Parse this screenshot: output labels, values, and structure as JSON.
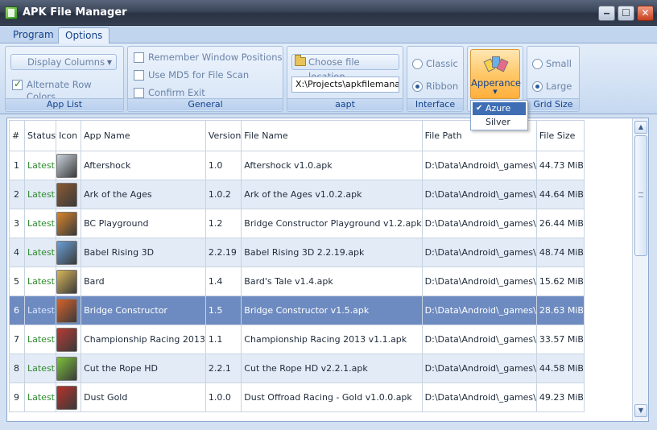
{
  "window": {
    "title": "APK File Manager",
    "minimize": "‒",
    "maximize": "☐",
    "close": "✕"
  },
  "tabs": [
    {
      "label": "Program"
    },
    {
      "label": "Options"
    }
  ],
  "ribbon": {
    "app_list": {
      "label": "App List",
      "display_columns": "Display Columns",
      "alternate_row_colors": "Alternate Row Colors",
      "alternate_row_colors_checked": true
    },
    "general": {
      "label": "General",
      "remember_window_positions": "Remember Window Positions",
      "use_md5": "Use MD5 for File Scan",
      "confirm_exit": "Confirm Exit"
    },
    "aapt": {
      "label": "aapt",
      "choose_file_location": "Choose file location",
      "path_value": "X:\\Projects\\apkfilemanage"
    },
    "interface": {
      "label": "Interface",
      "classic": "Classic",
      "ribbon": "Ribbon",
      "selected": "Ribbon"
    },
    "appearance": {
      "label": "Apperance",
      "options": [
        "Azure",
        "Silver"
      ],
      "selected": "Azure"
    },
    "grid_size": {
      "label": "Grid Size",
      "small": "Small",
      "large": "Large",
      "selected": "Large"
    }
  },
  "grid": {
    "columns": [
      "#",
      "Status",
      "Icon",
      "App Name",
      "Version",
      "File Name",
      "File Path",
      "File Size"
    ],
    "rows": [
      {
        "num": "1",
        "status": "Latest",
        "app": "Aftershock",
        "version": "1.0",
        "file": "Aftershock v1.0.apk",
        "path": "D:\\Data\\Android\\_games\\",
        "size": "44.73 MiB",
        "icon_color": "#c9d2dc"
      },
      {
        "num": "2",
        "status": "Latest",
        "app": "Ark of the Ages",
        "version": "1.0.2",
        "file": "Ark of the Ages v1.0.2.apk",
        "path": "D:\\Data\\Android\\_games\\",
        "size": "44.64 MiB",
        "icon_color": "#8a5a32"
      },
      {
        "num": "3",
        "status": "Latest",
        "app": "BC Playground",
        "version": "1.2",
        "file": "Bridge Constructor Playground v1.2.apk",
        "path": "D:\\Data\\Android\\_games\\",
        "size": "26.44 MiB",
        "icon_color": "#d9852a"
      },
      {
        "num": "4",
        "status": "Latest",
        "app": "Babel Rising 3D",
        "version": "2.2.19",
        "file": "Babel Rising 3D 2.2.19.apk",
        "path": "D:\\Data\\Android\\_games\\",
        "size": "48.74 MiB",
        "icon_color": "#6aa0d8"
      },
      {
        "num": "5",
        "status": "Latest",
        "app": "Bard",
        "version": "1.4",
        "file": "Bard's Tale v1.4.apk",
        "path": "D:\\Data\\Android\\_games\\",
        "size": "15.62 MiB",
        "icon_color": "#d8b65a"
      },
      {
        "num": "6",
        "status": "Latest",
        "app": "Bridge Constructor",
        "version": "1.5",
        "file": "Bridge Constructor v1.5.apk",
        "path": "D:\\Data\\Android\\_games\\",
        "size": "28.63 MiB",
        "icon_color": "#d8622a"
      },
      {
        "num": "7",
        "status": "Latest",
        "app": "Championship Racing 2013",
        "version": "1.1",
        "file": "Championship Racing 2013 v1.1.apk",
        "path": "D:\\Data\\Android\\_games\\",
        "size": "33.57 MiB",
        "icon_color": "#b83a32"
      },
      {
        "num": "8",
        "status": "Latest",
        "app": "Cut the Rope HD",
        "version": "2.2.1",
        "file": "Cut the Rope HD v2.2.1.apk",
        "path": "D:\\Data\\Android\\_games\\",
        "size": "44.58 MiB",
        "icon_color": "#7ac23a"
      },
      {
        "num": "9",
        "status": "Latest",
        "app": "Dust Gold",
        "version": "1.0.0",
        "file": "Dust Offroad Racing - Gold v1.0.0.apk",
        "path": "D:\\Data\\Android\\_games\\",
        "size": "49.23 MiB",
        "icon_color": "#b8322a"
      }
    ],
    "selected_row": 6
  },
  "colors": {
    "selected_row": "#6d8bc0",
    "alt_row": "#e3ebf6",
    "status_latest": "#2e8a2e",
    "accent": "#15428b"
  }
}
